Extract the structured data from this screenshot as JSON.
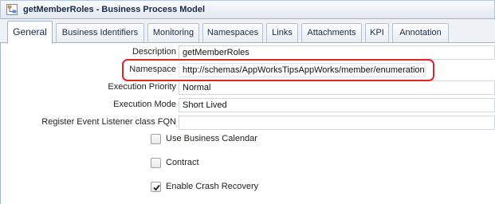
{
  "window": {
    "title": "getMemberRoles - Business Process Model"
  },
  "tabs": [
    {
      "label": "General"
    },
    {
      "label": "Business Identifiers"
    },
    {
      "label": "Monitoring"
    },
    {
      "label": "Namespaces"
    },
    {
      "label": "Links"
    },
    {
      "label": "Attachments"
    },
    {
      "label": "KPI"
    },
    {
      "label": "Annotation"
    }
  ],
  "form": {
    "description": {
      "label": "Description",
      "value": "getMemberRoles"
    },
    "namespace": {
      "label": "Namespace",
      "value": "http://schemas/AppWorksTipsAppWorks/member/enumeration"
    },
    "execution_priority": {
      "label": "Execution Priority",
      "value": "Normal"
    },
    "execution_mode": {
      "label": "Execution Mode",
      "value": "Short Lived"
    },
    "event_listener": {
      "label": "Register Event Listener class FQN",
      "value": ""
    }
  },
  "checkboxes": [
    {
      "label": "Use Business Calendar",
      "checked": false
    },
    {
      "label": "Contract",
      "checked": false
    },
    {
      "label": "Enable Crash Recovery",
      "checked": true
    }
  ],
  "colors": {
    "highlight": "#e0262b",
    "tab_border": "#9fb3cd"
  }
}
